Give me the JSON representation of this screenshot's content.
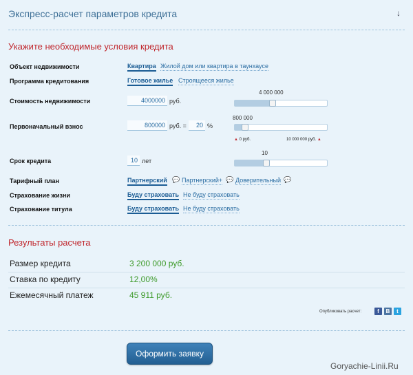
{
  "header": {
    "title": "Экспресс-расчет параметров кредита",
    "collapse_icon": "down-arrow-icon"
  },
  "conditions": {
    "title": "Укажите необходимые условия кредита",
    "property": {
      "label": "Объект недвижимости",
      "options": [
        "Квартира",
        "Жилой дом или квартира в таунхаусе"
      ],
      "selected": "Квартира"
    },
    "program": {
      "label": "Программа кредитования",
      "options": [
        "Готовое жилье",
        "Строящееся жилье"
      ],
      "selected": "Готовое жилье"
    },
    "cost": {
      "label": "Стоимость недвижимости",
      "value": "4000000",
      "unit": "руб.",
      "slider_value": "4 000 000",
      "slider_fraction": 0.4
    },
    "down_payment": {
      "label": "Первоначальный взнос",
      "value": "800000",
      "unit": "руб. =",
      "percent": "20",
      "percent_sign": "%",
      "slider_value": "800 000",
      "slider_fraction": 0.08,
      "range_min": "0 руб.",
      "range_max": "10 000 000 руб."
    },
    "term": {
      "label": "Срок кредита",
      "value": "10",
      "unit": "лет",
      "slider_value": "10",
      "slider_fraction": 0.33
    },
    "tariff": {
      "label": "Тарифный план",
      "options": [
        "Партнерский",
        "Партнерский+",
        "Доверительный"
      ],
      "selected": "Партнерский"
    },
    "life_insurance": {
      "label": "Страхование жизни",
      "options": [
        "Буду страховать",
        "Не буду страховать"
      ],
      "selected": "Буду страховать"
    },
    "title_insurance": {
      "label": "Страхование титула",
      "options": [
        "Буду страховать",
        "Не буду страховать"
      ],
      "selected": "Буду страховать"
    }
  },
  "results": {
    "title": "Результаты расчета",
    "rows": [
      {
        "label": "Размер кредита",
        "value": "3 200 000 руб."
      },
      {
        "label": "Ставка по кредиту",
        "value": "12,00%"
      },
      {
        "label": "Ежемесячный платеж",
        "value": "45 911 руб."
      }
    ]
  },
  "share": {
    "label": "Опубликовать расчет:",
    "networks": [
      {
        "name": "facebook-icon",
        "glyph": "f",
        "color": "#3b5998"
      },
      {
        "name": "vkontakte-icon",
        "glyph": "В",
        "color": "#4c75a3"
      },
      {
        "name": "twitter-icon",
        "glyph": "t",
        "color": "#2aa3e0"
      }
    ]
  },
  "submit": {
    "label": "Оформить заявку"
  },
  "watermark": "Goryachie-Linii.Ru"
}
